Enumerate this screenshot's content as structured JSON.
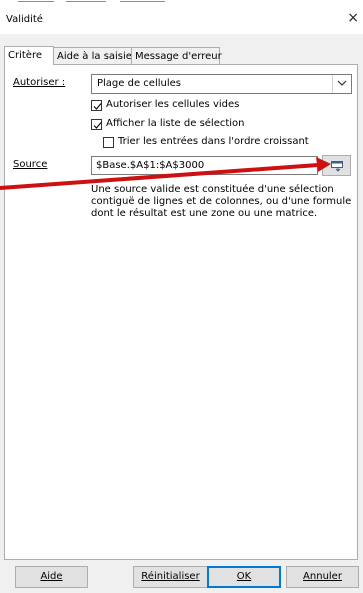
{
  "window": {
    "title": "Validité",
    "close_glyph": "×"
  },
  "tabs": [
    {
      "label": "Critère",
      "active": true
    },
    {
      "label": "Aide à la saisie",
      "active": false
    },
    {
      "label": "Message d'erreur",
      "active": false
    }
  ],
  "criteria": {
    "allow_label": "Autoriser :",
    "allow_value": "Plage de cellules",
    "options": [
      {
        "label": "Autoriser les cellules vides",
        "checked": true
      },
      {
        "label": "Afficher la liste de sélection",
        "checked": true
      },
      {
        "label": "Trier les entrées dans l'ordre croissant",
        "checked": false
      }
    ],
    "source_label": "Source",
    "source_value": "$Base.$A$1:$A$3000",
    "help_lines": [
      "Une source valide est constituée d'une sélection",
      "contiguë de lignes et de colonnes, ou d'une formule",
      "dont le résultat est une zone ou une matrice."
    ]
  },
  "buttons": {
    "help": "Aide",
    "reset": "Réinitialiser",
    "ok": "OK",
    "cancel": "Annuler"
  },
  "colors": {
    "annotation_arrow": "#cc1111",
    "default_button_border": "#0078d7"
  }
}
